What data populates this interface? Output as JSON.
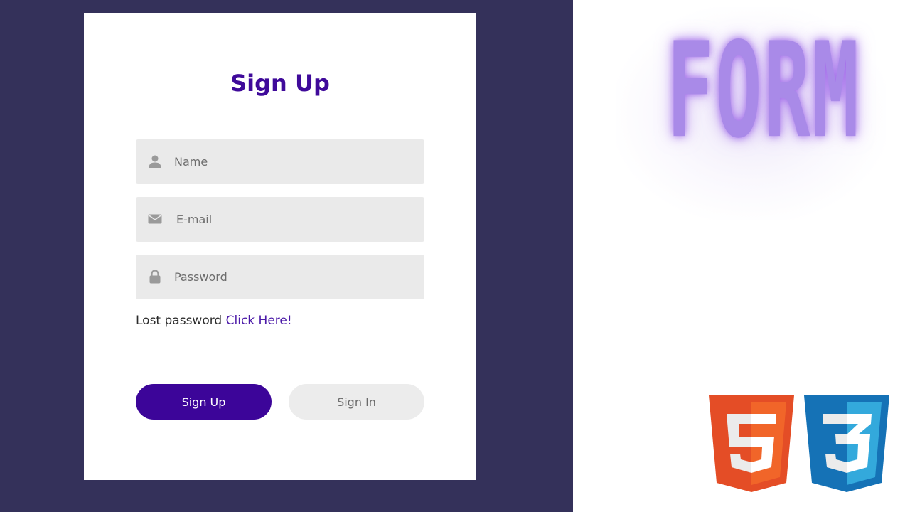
{
  "form": {
    "title": "Sign Up",
    "name_placeholder": "Name",
    "email_placeholder": "E-mail",
    "password_placeholder": "Password",
    "lost_text": "Lost password",
    "lost_link": "Click Here!",
    "signup_label": "Sign Up",
    "signin_label": "Sign In"
  },
  "icons": {
    "name": "user-icon",
    "email": "envelope-icon",
    "password": "lock-icon"
  },
  "banner": {
    "headline": "FORM",
    "logos": [
      "html5-logo",
      "css3-logo"
    ]
  },
  "colors": {
    "panel_bg": "#34315a",
    "accent": "#3c0599",
    "title": "#3f0a9a",
    "link": "#4b1aa8",
    "headline": "#a98ae8",
    "html5": "#e44d26",
    "css3": "#1572b6"
  }
}
